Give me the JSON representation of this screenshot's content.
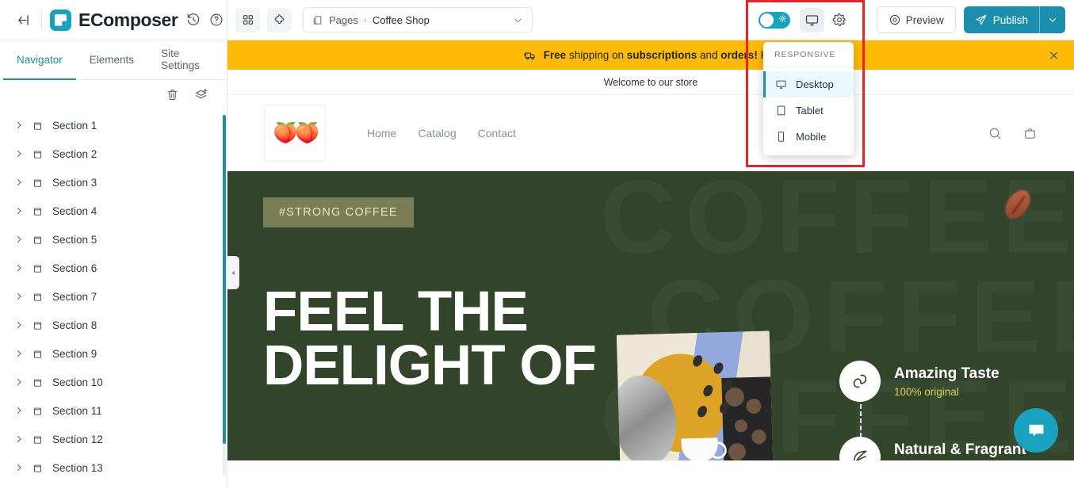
{
  "app": {
    "brand_name": "EComposer",
    "back_label": "back",
    "history_icon": "history-icon",
    "help_icon": "help-circle-icon"
  },
  "left_panel": {
    "tabs": [
      {
        "label": "Navigator",
        "active": true
      },
      {
        "label": "Elements",
        "active": false
      },
      {
        "label": "Site Settings",
        "active": false
      }
    ],
    "tools": [
      {
        "name": "delete-icon",
        "label": "Delete"
      },
      {
        "name": "add-layer-icon",
        "label": "Add Section"
      }
    ],
    "sections": [
      {
        "label": "Section 1"
      },
      {
        "label": "Section 2"
      },
      {
        "label": "Section 3"
      },
      {
        "label": "Section 4"
      },
      {
        "label": "Section 5"
      },
      {
        "label": "Section 6"
      },
      {
        "label": "Section 7"
      },
      {
        "label": "Section 8"
      },
      {
        "label": "Section 9"
      },
      {
        "label": "Section 10"
      },
      {
        "label": "Section 11"
      },
      {
        "label": "Section 12"
      },
      {
        "label": "Section 13"
      }
    ]
  },
  "top_bar": {
    "grid_icon": "grid-apps-icon",
    "extension_icon": "puzzle-extension-icon",
    "page_select": {
      "group_icon": "pages-icon",
      "group_label": "Pages",
      "separator": "›",
      "current_page": "Coffee Shop",
      "caret_icon": "chevron-down-icon"
    },
    "theme_toggle": {
      "name": "light-mode-toggle",
      "state": "on",
      "icon": "sun-icon"
    },
    "device_icon": "desktop-monitor-icon",
    "settings_icon": "gear-icon",
    "preview_label": "Preview",
    "preview_icon": "eye-icon",
    "publish_label": "Publish",
    "publish_icon": "paper-plane-icon",
    "publish_caret_icon": "chevron-down-icon"
  },
  "responsive_menu": {
    "heading": "RESPONSIVE",
    "items": [
      {
        "label": "Desktop",
        "icon": "desktop-icon",
        "selected": true
      },
      {
        "label": "Tablet",
        "icon": "tablet-icon",
        "selected": false
      },
      {
        "label": "Mobile",
        "icon": "mobile-icon",
        "selected": false
      }
    ]
  },
  "canvas": {
    "announcement": {
      "icon": "delivery-truck-icon",
      "bold1": "Free",
      "mid1": " shipping on ",
      "bold2": "subscriptions",
      "mid2": " and ",
      "bold3": "orders!",
      "tail": " Hur",
      "close_icon": "close-icon"
    },
    "welcome_text": "Welcome to our store",
    "store_header": {
      "logo_glyph": "🍑🍑",
      "nav": [
        "Home",
        "Catalog",
        "Contact"
      ],
      "search_icon": "search-icon",
      "cart_icon": "shopping-bag-icon"
    },
    "hero": {
      "watermark": "COFFEE",
      "tag": "#STRONG COFFEE",
      "headline_line1": "FEEL THE",
      "headline_line2": "DELIGHT OF",
      "bean_icon": "coffee-bean-icon",
      "features": [
        {
          "icon": "coffee-leaf-icon",
          "title": "Amazing Taste",
          "subtitle": "100% original"
        },
        {
          "icon": "leaf-icon",
          "title": "Natural & Fragrant",
          "subtitle": ""
        }
      ]
    },
    "chat_icon": "chat-bubble-icon",
    "collapse_icon": "chevron-left-icon"
  },
  "colors": {
    "accent": "#1b8fab",
    "toggle_on": "#17a2bd",
    "banner_yellow": "#fdba07",
    "hero_green": "#32452b",
    "highlight_red": "#ee2222",
    "feature_yellow": "#d8d34e"
  }
}
